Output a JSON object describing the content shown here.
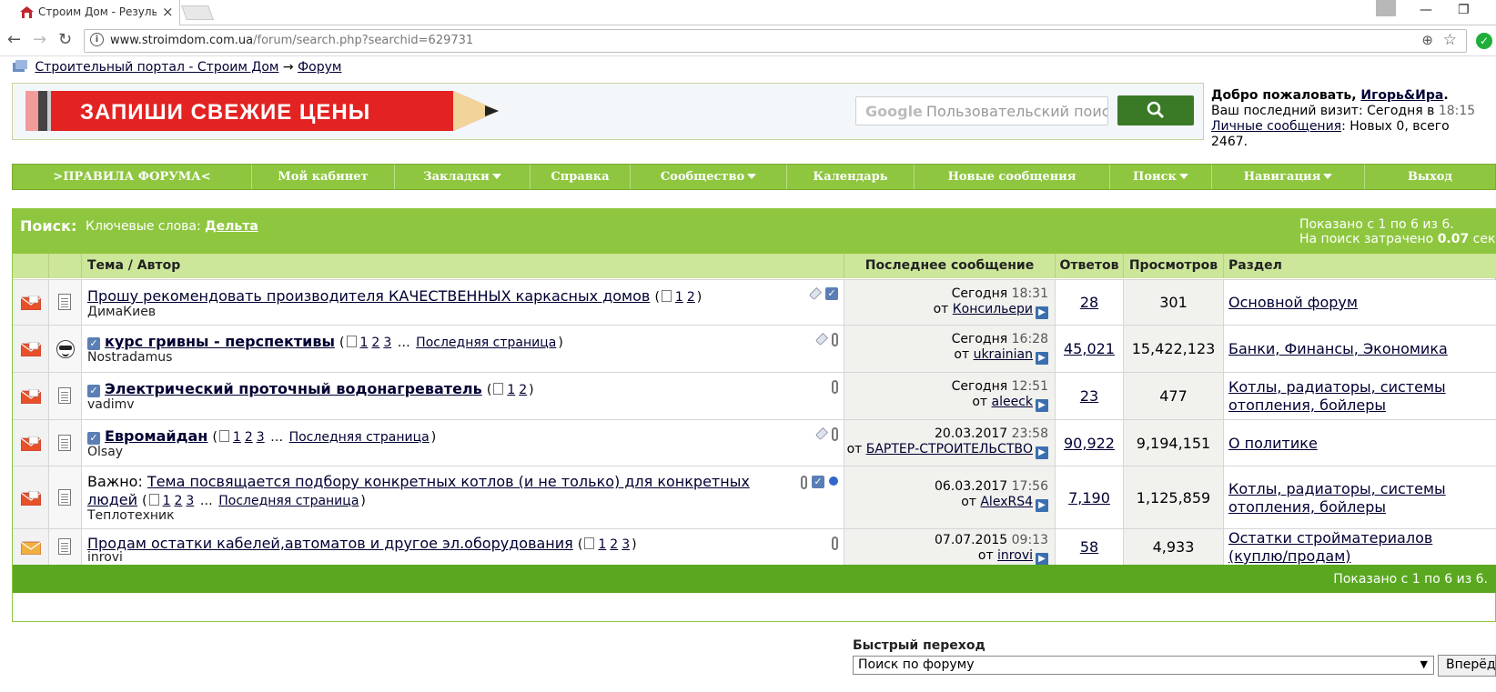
{
  "browser": {
    "tab_title": "Строим Дом - Результаты",
    "url_host": "www.stroimdom.com.ua",
    "url_path": "/forum/search.php?searchid=629731"
  },
  "breadcrumb": {
    "portal": "Строительный портал - Строим Дом",
    "sep": "→",
    "forum": "Форум"
  },
  "banner": {
    "ad_text": "ЗАПИШИ СВЕЖИЕ ЦЕНЫ",
    "search_brand": "Google",
    "search_placeholder": "Пользовательский поис"
  },
  "welcome": {
    "greeting": "Добро пожаловать, ",
    "user": "Игорь&Ира",
    "dot": ".",
    "last_visit_label": "Ваш последний визит: Сегодня в ",
    "last_visit_time": "18:15",
    "pm_link": "Личные сообщения",
    "pm_text": ": Новых 0, всего 2467."
  },
  "menu": [
    {
      "label": ">ПРАВИЛА ФОРУМА<",
      "dropdown": false
    },
    {
      "label": "Мой кабинет",
      "dropdown": false
    },
    {
      "label": "Закладки",
      "dropdown": true
    },
    {
      "label": "Справка",
      "dropdown": false
    },
    {
      "label": "Сообщество",
      "dropdown": true
    },
    {
      "label": "Календарь",
      "dropdown": false
    },
    {
      "label": "Новые сообщения",
      "dropdown": false
    },
    {
      "label": "Поиск",
      "dropdown": true
    },
    {
      "label": "Навигация",
      "dropdown": true
    },
    {
      "label": "Выход",
      "dropdown": false
    }
  ],
  "results": {
    "search_label": "Поиск:",
    "keywords_label": "Ключевые слова: ",
    "keyword": "Дельта",
    "shown": "Показано с 1 по 6 из 6.",
    "time_label": "На поиск затрачено ",
    "time_value": "0.07",
    "time_unit": " сек.",
    "columns": {
      "topic": "Тема / Автор",
      "last": "Последнее сообщение",
      "replies": "Ответов",
      "views": "Просмотров",
      "forum": "Раздел"
    },
    "footer": "Показано с 1 по 6 из 6.",
    "rows": [
      {
        "prefix": "",
        "title": "Прошу рекомендовать производителя КАЧЕСТВЕННЫХ каркасных домов",
        "title2": "",
        "bold": false,
        "checked": false,
        "pages": [
          "1",
          "2"
        ],
        "last_page": "",
        "author": "ДимаКиев",
        "icons": [
          "tag",
          "check"
        ],
        "last_date": "Сегодня",
        "last_time": "18:31",
        "last_from": "от ",
        "last_user": "Консильери",
        "replies": "28",
        "views": "301",
        "forum": "Основной форум",
        "forum2": ""
      },
      {
        "prefix": "",
        "title": "курс гривны - перспективы",
        "title2": "",
        "bold": true,
        "checked": true,
        "pages": [
          "1",
          "2",
          "3"
        ],
        "last_page": "Последняя страница",
        "author": "Nostradamus",
        "icons": [
          "tag",
          "clip"
        ],
        "last_date": "Сегодня",
        "last_time": "16:28",
        "last_from": "от ",
        "last_user": "ukrainian",
        "replies": "45,021",
        "views": "15,422,123",
        "forum": "Банки, Финансы, Экономика",
        "forum2": ""
      },
      {
        "prefix": "",
        "title": "Электрический проточный водонагреватель",
        "title2": "",
        "bold": true,
        "checked": true,
        "pages": [
          "1",
          "2"
        ],
        "last_page": "",
        "author": "vadimv",
        "icons": [
          "clip"
        ],
        "last_date": "Сегодня",
        "last_time": "12:51",
        "last_from": "от ",
        "last_user": "aleeck",
        "replies": "23",
        "views": "477",
        "forum": "Котлы, радиаторы, системы",
        "forum2": "отопления, бойлеры"
      },
      {
        "prefix": "",
        "title": "Евромайдан",
        "title2": "",
        "bold": true,
        "checked": true,
        "pages": [
          "1",
          "2",
          "3"
        ],
        "last_page": "Последняя страница",
        "author": "Olsay",
        "icons": [
          "tag",
          "clip"
        ],
        "last_date": "20.03.2017",
        "last_time": "23:58",
        "last_from": "от ",
        "last_user": "БАРТЕР-СТРОИТЕЛЬСТВО",
        "replies": "90,922",
        "views": "9,194,151",
        "forum": "О политике",
        "forum2": ""
      },
      {
        "prefix": "Важно: ",
        "title": "Тема посвящается подбору конкретных котлов (и не только) для конкретных",
        "title2": "людей",
        "bold": false,
        "checked": false,
        "pages": [
          "1",
          "2",
          "3"
        ],
        "last_page": "Последняя страница",
        "author": "Теплотехник",
        "icons": [
          "clip",
          "check",
          "pin"
        ],
        "last_date": "06.03.2017",
        "last_time": "17:56",
        "last_from": "от ",
        "last_user": "AlexRS4",
        "replies": "7,190",
        "views": "1,125,859",
        "forum": "Котлы, радиаторы, системы",
        "forum2": "отопления, бойлеры"
      },
      {
        "prefix": "",
        "title": "Продам остатки кабелей,автоматов и другое эл.оборудования",
        "title2": "",
        "bold": false,
        "checked": false,
        "pages": [
          "1",
          "2",
          "3"
        ],
        "last_page": "",
        "author": "inrovi",
        "icons": [
          "clip"
        ],
        "last_date": "07.07.2015",
        "last_time": "09:13",
        "last_from": "от ",
        "last_user": "inrovi",
        "replies": "58",
        "views": "4,933",
        "forum": "Остатки стройматериалов",
        "forum2": "(куплю/продам)"
      }
    ]
  },
  "quick_nav": {
    "label": "Быстрый переход",
    "selected": "Поиск по форуму",
    "button": "Вперёд"
  },
  "colors": {
    "menu_green": "#8ec63f",
    "footer_green": "#5aa820",
    "link": "#000033",
    "search_btn": "#3a7a27"
  }
}
